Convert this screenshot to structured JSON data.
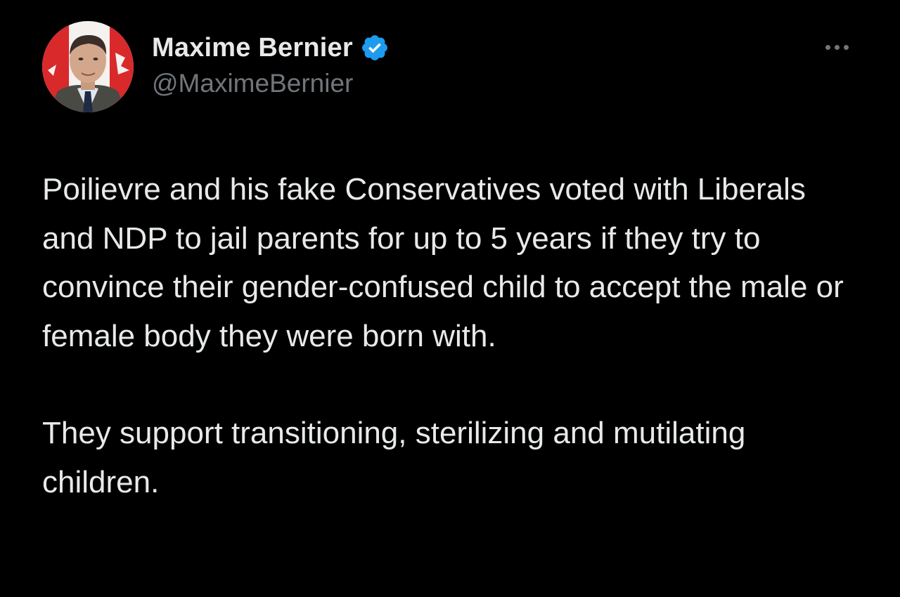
{
  "tweet": {
    "author": {
      "display_name": "Maxime Bernier",
      "handle": "@MaximeBernier",
      "verified": true
    },
    "body_paragraphs": [
      "Poilievre and his fake Conservatives voted with Liberals and NDP to jail parents for up to 5 years if they try to convince their gender-confused child to accept the male or female body they were born with.",
      "They support transitioning, sterilizing and mutilating children."
    ]
  },
  "icons": {
    "verified": "verified-badge-icon",
    "more": "more-options-icon"
  },
  "colors": {
    "background": "#000000",
    "primary_text": "#e7e9ea",
    "secondary_text": "#71767b",
    "verified_blue": "#1d9bf0"
  }
}
